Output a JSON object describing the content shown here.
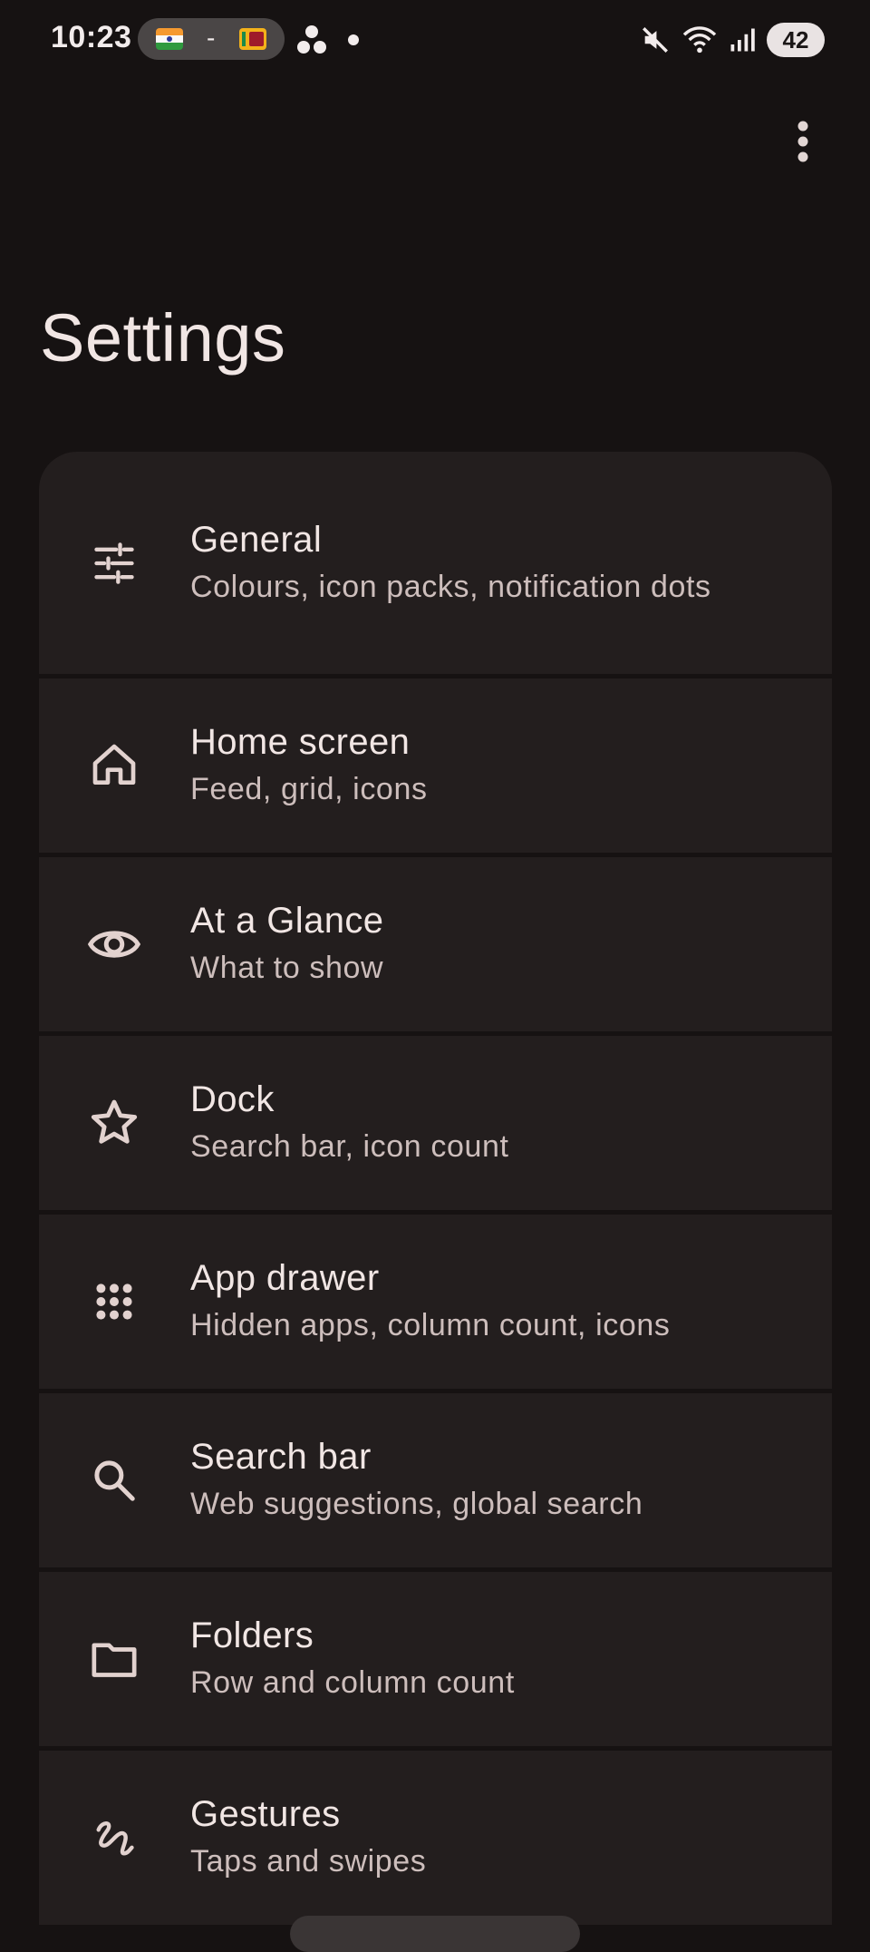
{
  "status_bar": {
    "time": "10:23",
    "flag_separator": "-",
    "battery": "42"
  },
  "page": {
    "title": "Settings"
  },
  "settings": [
    {
      "id": "general",
      "icon": "sliders-icon",
      "title": "General",
      "subtitle": "Colours, icon packs, notification dots"
    },
    {
      "id": "home-screen",
      "icon": "home-icon",
      "title": "Home screen",
      "subtitle": "Feed, grid, icons"
    },
    {
      "id": "at-a-glance",
      "icon": "eye-icon",
      "title": "At a Glance",
      "subtitle": "What to show"
    },
    {
      "id": "dock",
      "icon": "star-icon",
      "title": "Dock",
      "subtitle": "Search bar, icon count"
    },
    {
      "id": "app-drawer",
      "icon": "grid-dots-icon",
      "title": "App drawer",
      "subtitle": "Hidden apps, column count, icons"
    },
    {
      "id": "search-bar",
      "icon": "search-icon",
      "title": "Search bar",
      "subtitle": "Web suggestions, global search"
    },
    {
      "id": "folders",
      "icon": "folder-icon",
      "title": "Folders",
      "subtitle": "Row and column count"
    },
    {
      "id": "gestures",
      "icon": "gesture-icon",
      "title": "Gestures",
      "subtitle": "Taps and swipes"
    }
  ],
  "colors": {
    "background": "#161212",
    "card": "#231e1e",
    "text_primary": "#f1e6e4",
    "text_secondary": "#cdbebc",
    "icon": "#e2d2cf"
  }
}
